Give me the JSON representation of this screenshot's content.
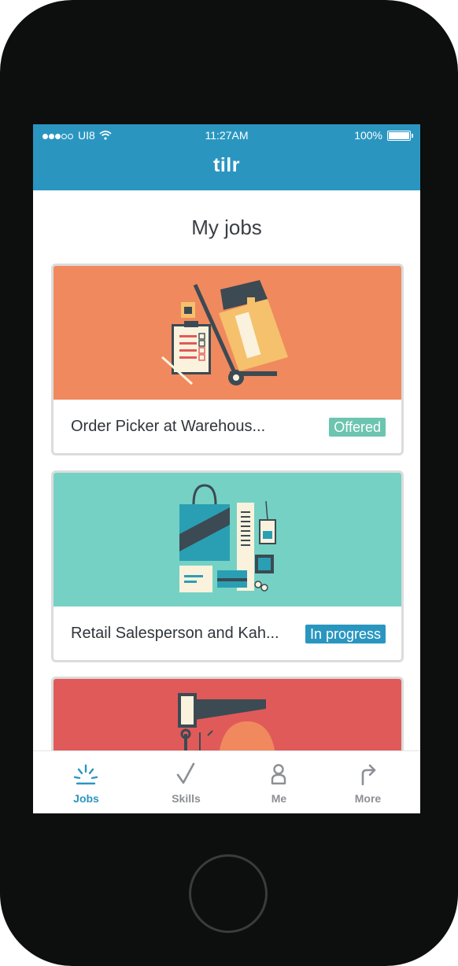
{
  "status_bar": {
    "carrier": "UI8",
    "time": "11:27AM",
    "battery": "100%"
  },
  "app": {
    "logo": "tilr"
  },
  "page": {
    "title": "My jobs"
  },
  "jobs": [
    {
      "title": "Order Picker at Warehous...",
      "status": "Offered",
      "status_color": "#6cc5b0",
      "hero_color": "#f0895e"
    },
    {
      "title": "Retail Salesperson and Kah...",
      "status": "In progress",
      "status_color": "#2a96c0",
      "hero_color": "#75d1c4"
    },
    {
      "title": "",
      "status": "",
      "hero_color": "#e05a5a"
    }
  ],
  "tabbar": {
    "items": [
      {
        "label": "Jobs",
        "icon": "sunrise-icon",
        "active": true
      },
      {
        "label": "Skills",
        "icon": "checkmark-icon",
        "active": false
      },
      {
        "label": "Me",
        "icon": "person-icon",
        "active": false
      },
      {
        "label": "More",
        "icon": "share-arrow-icon",
        "active": false
      }
    ]
  },
  "colors": {
    "primary": "#2a96c0",
    "offered": "#6cc5b0",
    "in_progress": "#2a96c0"
  }
}
